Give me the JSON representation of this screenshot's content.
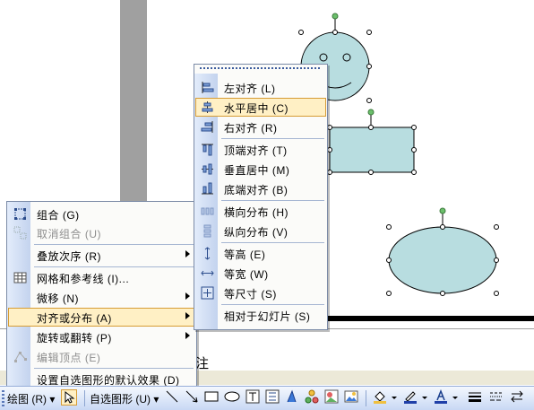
{
  "notes": {
    "text": "注"
  },
  "main_menu": {
    "items": [
      {
        "label": "组合 (G)",
        "icon": "group-icon",
        "disabled": false
      },
      {
        "label": "取消组合 (U)",
        "icon": "ungroup-icon",
        "disabled": true
      },
      {
        "label": "叠放次序 (R)",
        "submenu": true
      },
      {
        "label": "网格和参考线 (I)...",
        "icon": "grid-icon"
      },
      {
        "label": "微移 (N)",
        "submenu": true
      },
      {
        "label": "对齐或分布 (A)",
        "submenu": true,
        "highlighted": true
      },
      {
        "label": "旋转或翻转 (P)",
        "submenu": true
      },
      {
        "label": "编辑顶点 (E)",
        "icon": "edit-points-icon",
        "disabled": true
      },
      {
        "label": "设置自选图形的默认效果 (D)"
      }
    ]
  },
  "align_menu": {
    "items": [
      {
        "label": "左对齐 (L)",
        "icon": "align-left-icon"
      },
      {
        "label": "水平居中 (C)",
        "icon": "align-center-icon",
        "highlighted": true
      },
      {
        "label": "右对齐 (R)",
        "icon": "align-right-icon"
      },
      {
        "label": "顶端对齐 (T)",
        "icon": "align-top-icon"
      },
      {
        "label": "垂直居中 (M)",
        "icon": "align-middle-icon"
      },
      {
        "label": "底端对齐 (B)",
        "icon": "align-bottom-icon"
      },
      {
        "label": "横向分布 (H)",
        "icon": "distribute-horizontal-icon"
      },
      {
        "label": "纵向分布 (V)",
        "icon": "distribute-vertical-icon"
      },
      {
        "label": "等高 (E)",
        "icon": "same-height-icon"
      },
      {
        "label": "等宽 (W)",
        "icon": "same-width-icon"
      },
      {
        "label": "等尺寸 (S)",
        "icon": "same-size-icon"
      },
      {
        "label": "相对于幻灯片 (S)"
      }
    ]
  },
  "toolbar": {
    "draw_label": "绘图 (R) ▾",
    "autoshapes_label": "自选图形 (U) ▾"
  },
  "colors": {
    "shape_fill": "#b8dde0",
    "highlight": "#fff0c5",
    "handle_green": "#6bbf6b"
  }
}
